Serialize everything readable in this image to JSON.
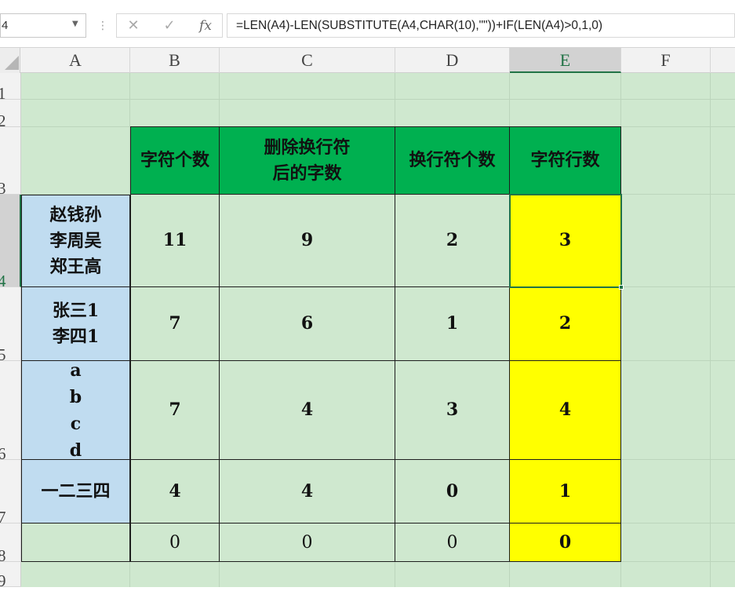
{
  "formula_bar": {
    "name_box": "4",
    "cancel_icon": "✕",
    "enter_icon": "✓",
    "fx_label": "fx",
    "formula": "=LEN(A4)-LEN(SUBSTITUTE(A4,CHAR(10),\"\"))+IF(LEN(A4)>0,1,0)"
  },
  "columns": [
    "A",
    "B",
    "C",
    "D",
    "E",
    "F"
  ],
  "rows": [
    "1",
    "2",
    "3",
    "4",
    "5",
    "6",
    "7",
    "8",
    "9"
  ],
  "selected_cell": "E4",
  "table": {
    "headers": [
      "字符个数",
      "删除换行符\n后的字数",
      "换行符个数",
      "字符行数"
    ],
    "rows": [
      {
        "a": "赵钱孙\n李周吴\n郑王高",
        "b": "11",
        "c": "9",
        "d": "2",
        "e": "3"
      },
      {
        "a": "张三1\n李四1",
        "b": "7",
        "c": "6",
        "d": "1",
        "e": "2"
      },
      {
        "a": "a\nb\nc\nd",
        "b": "7",
        "c": "4",
        "d": "3",
        "e": "4"
      },
      {
        "a": "一二三四",
        "b": "4",
        "c": "4",
        "d": "0",
        "e": "1"
      },
      {
        "a": "",
        "b": "0",
        "c": "0",
        "d": "0",
        "e": "0"
      }
    ]
  },
  "colors": {
    "header_fill": "#00b050",
    "source_fill": "#c0dcf0",
    "result_fill": "#ffff00",
    "sheet_background": "#cfe8cf",
    "selection": "#217346"
  }
}
